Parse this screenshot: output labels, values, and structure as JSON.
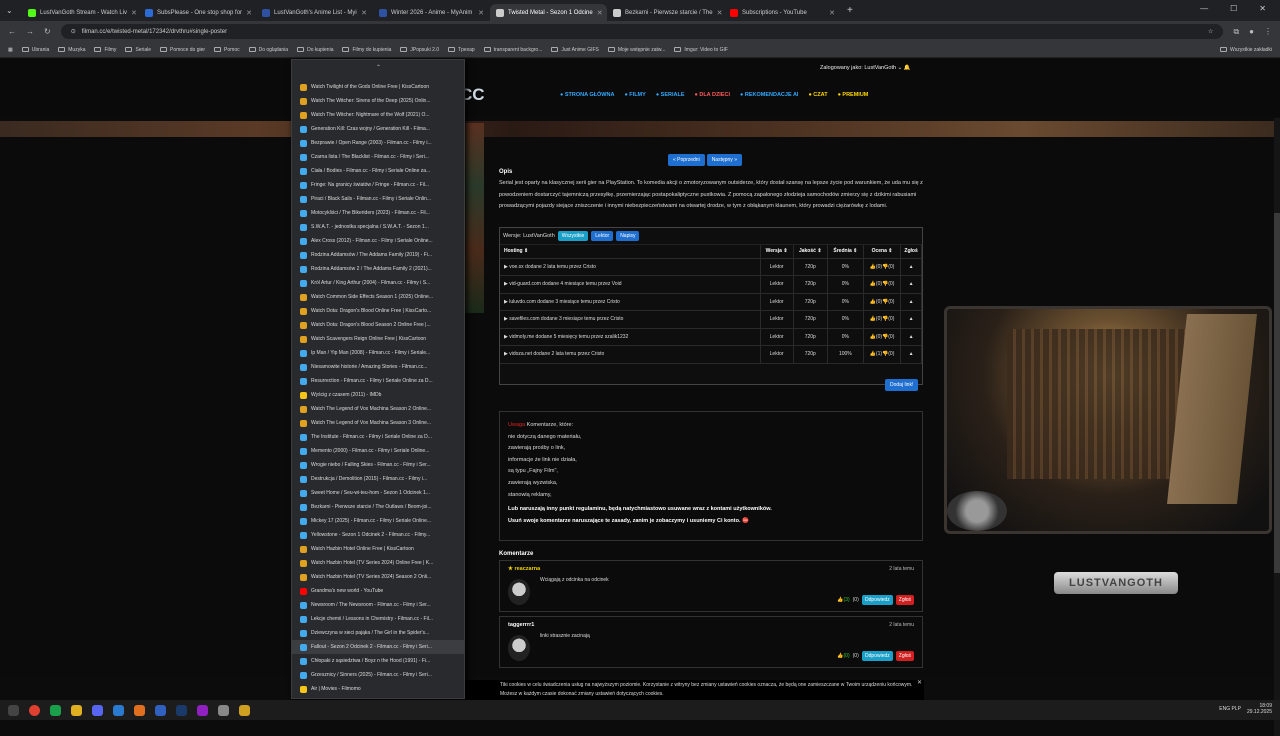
{
  "browser": {
    "tabs": [
      {
        "title": "LustVanGoth Stream - Watch Liv",
        "color": "#53fc18",
        "active": false
      },
      {
        "title": "SubsPlease - One stop shop for",
        "color": "#2b6cd6",
        "active": false
      },
      {
        "title": "LustVanGoth's Anime List - Myi",
        "color": "#2e51a2",
        "active": false
      },
      {
        "title": "Winter 2026 - Anime - MyAnim",
        "color": "#2e51a2",
        "active": false
      },
      {
        "title": "Twisted Metal - Sezon 1 Odcine",
        "color": "#cccccc",
        "active": true
      },
      {
        "title": "Bezkarni - Pierwsze starcie / The",
        "color": "#cccccc",
        "active": false
      },
      {
        "title": "Subscriptions - YouTube",
        "color": "#ff0000",
        "active": false
      }
    ],
    "url": "filman.cc/e/twisted-metal/172342/drvthru#single-poster",
    "bookmarks": [
      "Ubrania",
      "Muzyka",
      "Filmy",
      "Seriale",
      "Pomoce do gier",
      "Pomoc",
      "Do oglądania",
      "Do kupienia",
      "Filmy do kupienia",
      "JPopsuki 2.0",
      "Tpexap",
      "transparent backgro...",
      "Just Anime GIFS",
      "Moje wstępnie zatw...",
      "Imgur: Video to GIF"
    ],
    "all_bookmarks": "Wszystkie zakładki"
  },
  "site": {
    "logged_in": "Zalogowany jako: LustVanGoth",
    "nav": [
      {
        "label": "STRONA GŁÓWNA",
        "color": "#33aaff"
      },
      {
        "label": "FILMY",
        "color": "#33aaff"
      },
      {
        "label": "SERIALE",
        "color": "#33aaff"
      },
      {
        "label": "DLA DZIECI",
        "color": "#ff5a5a"
      },
      {
        "label": "REKOMENDACJE AI",
        "color": "#33aaff"
      },
      {
        "label": "CZAT",
        "color": "#ffd700"
      },
      {
        "label": "PREMIUM",
        "color": "#ffd700"
      }
    ],
    "prev_btn": "« Poprzedni",
    "next_btn": "Następny »",
    "opis_heading": "Opis",
    "opis_text": "Serial jest oparty na klasycznej serii gier na PlayStation. To komedia akcji o zmotoryzowanym outsiderze, który dostał szansę na lepsze życie pod warunkiem, że uda mu się z powodzeniem dostarczyć tajemniczą przesyłkę, przemierzając postapokaliptyczne pustkowia. Z pomocą zapalonego złodzieja samochodów zmierzy się z dzikimi rabusiami prowadzącymi pojazdy siejące zniszczenie i innymi niebezpieczeństwami na otwartej drodze, w tym z obłąkanym klaunem, który prowadzi ciężarówkę z lodami.",
    "versions_label": "Wersje: LustVanGoth",
    "version_chips": [
      {
        "label": "Wszystkie",
        "color": "#1aa0c8"
      },
      {
        "label": "Lektor",
        "color": "#1e6fd0"
      },
      {
        "label": "Napisy",
        "color": "#1e6fd0"
      }
    ],
    "table_headers": [
      "Hosting ⇕",
      "Wersja ⇕",
      "Jakość ⇕",
      "Średnia ⇕",
      "Ocena ⇕",
      "Zgłoś"
    ],
    "hosting_rows": [
      {
        "host": "voe.sx dodane 2 lata temu przez Cristo",
        "wersja": "Lektor",
        "jakosc": "720p",
        "srednia": "0%",
        "ocena": "👍(0)👎(0)"
      },
      {
        "host": "vid-guard.com dodane 4 miesiące temu przez Void",
        "wersja": "Lektor",
        "jakosc": "720p",
        "srednia": "0%",
        "ocena": "👍(0)👎(0)"
      },
      {
        "host": "luluvdo.com dodane 3 miesiące temu przez Cristo",
        "wersja": "Lektor",
        "jakosc": "720p",
        "srednia": "0%",
        "ocena": "👍(0)👎(0)"
      },
      {
        "host": "savefiles.com dodane 3 miesiące temu przez Cristo",
        "wersja": "Lektor",
        "jakosc": "720p",
        "srednia": "0%",
        "ocena": "👍(0)👎(0)"
      },
      {
        "host": "vidmoly.me dodane 5 miesięcy temu przez szalik1232",
        "wersja": "Lektor",
        "jakosc": "720p",
        "srednia": "0%",
        "ocena": "👍(0)👎(0)"
      },
      {
        "host": "vidoza.net dodane 2 lata temu przez Cristo",
        "wersja": "Lektor",
        "jakosc": "720p",
        "srednia": "100%",
        "ocena": "👍(1)👎(0)"
      }
    ],
    "dodaj_link": "Dodaj link!",
    "rules": {
      "uwaga": "Uwaga",
      "lines": [
        "Komentarze, które:",
        "nie dotyczą danego materiału,",
        "zawierają prośby o link,",
        "informacje że link nie działa,",
        "są typu „Fajny Film\",",
        "zawierają wyzwiska,",
        "stanowią reklamy,"
      ],
      "bold1": "Lub naruszają inny punkt regulaminu, będą natychmiastowo usuwane wraz z kontami użytkowników.",
      "bold2": "Usuń swoje komentarze naruszające te zasady, zanim je zobaczymy i usuniemy Ci konto. ⛔"
    },
    "comments_heading": "Komentarze",
    "comments": [
      {
        "user": "★ reaczarna",
        "user_color": "#f0d000",
        "time": "2 lata temu",
        "text": "Wciągają z odcinka na odcinek",
        "likes": "👍(3)",
        "dislikes": "(0)"
      },
      {
        "user": "taggerrrr1",
        "user_color": "#ffffff",
        "time": "2 lata temu",
        "text": "linki strasznie zacinają",
        "likes": "👍(0)",
        "dislikes": "(0)"
      }
    ],
    "reply_label": "Odpowiedz",
    "report_label": "Zgłoś",
    "cookie": "Tiki cookies w celu świadczenia usług na najwyższym poziomie. Korzystanie z witryny bez zmiany ustawień cookies oznacza, że będą one zamieszczane w Twoim urządzeniu końcowym. Możesz w każdym czasie dokonać zmiany ustawień dotyczących cookies."
  },
  "webcam": {
    "plate": "LUSTVANGOTH"
  },
  "dropdown": {
    "items": [
      {
        "t": "Watch Twilight of the Gods Online Free | KissCartoon",
        "c": "#e0a020"
      },
      {
        "t": "Watch The Witcher: Sirens of the Deep (2025) Onlin...",
        "c": "#e0a020"
      },
      {
        "t": "Watch The Witcher: Nightmare of the Wolf (2021) O...",
        "c": "#e0a020"
      },
      {
        "t": "Generation Kill: Czas wojny / Generation Kill - Filma...",
        "c": "#44aaee"
      },
      {
        "t": "Bezprawie / Open Range (2003) - Filman.cc - Filmy i...",
        "c": "#44aaee"
      },
      {
        "t": "Czarna lista / The Blacklist - Filman.cc - Filmy i Seri...",
        "c": "#44aaee"
      },
      {
        "t": "Ciała / Bodies - Filman.cc - Filmy i Seriale Online za...",
        "c": "#44aaee"
      },
      {
        "t": "Fringe: Na granicy światów / Fringe - Filman.cc - Fil...",
        "c": "#44aaee"
      },
      {
        "t": "Piraci / Black Sails - Filman.cc - Filmy i Seriale Onlin...",
        "c": "#44aaee"
      },
      {
        "t": "Motocykliści / The Bikeriders (2023) - Filman.cc - Fil...",
        "c": "#44aaee"
      },
      {
        "t": "S.W.A.T. - jednostka specjalna / S.W.A.T. - Sezon 1...",
        "c": "#44aaee"
      },
      {
        "t": "Alex Cross (2012) - Filman.cc - Filmy i Seriale Online...",
        "c": "#44aaee"
      },
      {
        "t": "Rodzina Addamsów / The Addams Family (2019) - Fi...",
        "c": "#44aaee"
      },
      {
        "t": "Rodzina Addamsów 2 / The Addams Family 2 (2021)...",
        "c": "#44aaee"
      },
      {
        "t": "Król Artur / King Arthur (2004) - Filman.cc - Filmy i S...",
        "c": "#44aaee"
      },
      {
        "t": "Watch Common Side Effects Season 1 (2025) Online...",
        "c": "#e0a020"
      },
      {
        "t": "Watch Dota: Dragon's Blood Online Free | KissCarto...",
        "c": "#e0a020"
      },
      {
        "t": "Watch Dota: Dragon's Blood Season 2 Online Free |...",
        "c": "#e0a020"
      },
      {
        "t": "Watch Scavengers Reign Online Free | KissCartoon",
        "c": "#e0a020"
      },
      {
        "t": "Ip Man / Yip Man (2008) - Filman.cc - Filmy i Seriale...",
        "c": "#44aaee"
      },
      {
        "t": "Niesamowite historie / Amazing Stories - Filman.cc...",
        "c": "#44aaee"
      },
      {
        "t": "Resurrection - Filman.cc - Filmy i Seriale Online za D...",
        "c": "#44aaee"
      },
      {
        "t": "Wyścig z czasem (2011) - IMDb",
        "c": "#f5c518"
      },
      {
        "t": "Watch The Legend of Vox Machina Season 2 Online...",
        "c": "#e0a020"
      },
      {
        "t": "Watch The Legend of Vox Machina Season 3 Online...",
        "c": "#e0a020"
      },
      {
        "t": "The Institute - Filman.cc - Filmy i Seriale Online za D...",
        "c": "#44aaee"
      },
      {
        "t": "Memento (2000) - Filman.cc - Filmy i Seriale Online...",
        "c": "#44aaee"
      },
      {
        "t": "Wrogie niebo / Falling Skies - Filman.cc - Filmy i Ser...",
        "c": "#44aaee"
      },
      {
        "t": "Destrukcja / Demolition (2015) - Filman.cc - Filmy i...",
        "c": "#44aaee"
      },
      {
        "t": "Sweet Home / Seu-wi-teu-hom - Sezon 1 Odcinek 1...",
        "c": "#44aaee"
      },
      {
        "t": "Bezkarni - Pierwsze starcie / The Outlaws / Beom-joi...",
        "c": "#44aaee"
      },
      {
        "t": "Mickey 17 (2025) - Filman.cc - Filmy i Seriale Online...",
        "c": "#44aaee"
      },
      {
        "t": "Yellowstone - Sezon 1 Odcinek 2 - Filman.cc - Filmy...",
        "c": "#44aaee"
      },
      {
        "t": "Watch Hazbin Hotel Online Free | KissCartoon",
        "c": "#e0a020"
      },
      {
        "t": "Watch Hazbin Hotel (TV Series 2024) Online Free | K...",
        "c": "#e0a020"
      },
      {
        "t": "Watch Hazbin Hotel (TV Series 2024) Season 2 Onli...",
        "c": "#e0a020"
      },
      {
        "t": "Grandma's new world - YouTube",
        "c": "#ff0000"
      },
      {
        "t": "Newsroom / The Newsroom - Filman.cc - Filmy i Ser...",
        "c": "#44aaee"
      },
      {
        "t": "Lekcje chemii / Lessons in Chemistry - Filman.cc - Fil...",
        "c": "#44aaee"
      },
      {
        "t": "Dziewczyna w sieci pająka / The Girl in the Spider's...",
        "c": "#44aaee"
      },
      {
        "t": "Fallout - Sezon 2 Odcinek 2 - Filman.cc - Filmy i Seri...",
        "c": "#44aaee"
      },
      {
        "t": "Chłopaki z sąsiedztwa / Boyz n the Hood (1991) - Fi...",
        "c": "#44aaee"
      },
      {
        "t": "Grzesznicy / Sinners (2025) - Filman.cc - Filmy i Seri...",
        "c": "#44aaee"
      },
      {
        "t": "Air | Movies - Filmomo",
        "c": "#f5c518"
      }
    ]
  },
  "tray": {
    "lang": "ENG PLP",
    "time": "18:09",
    "date": "29.12.2025"
  }
}
